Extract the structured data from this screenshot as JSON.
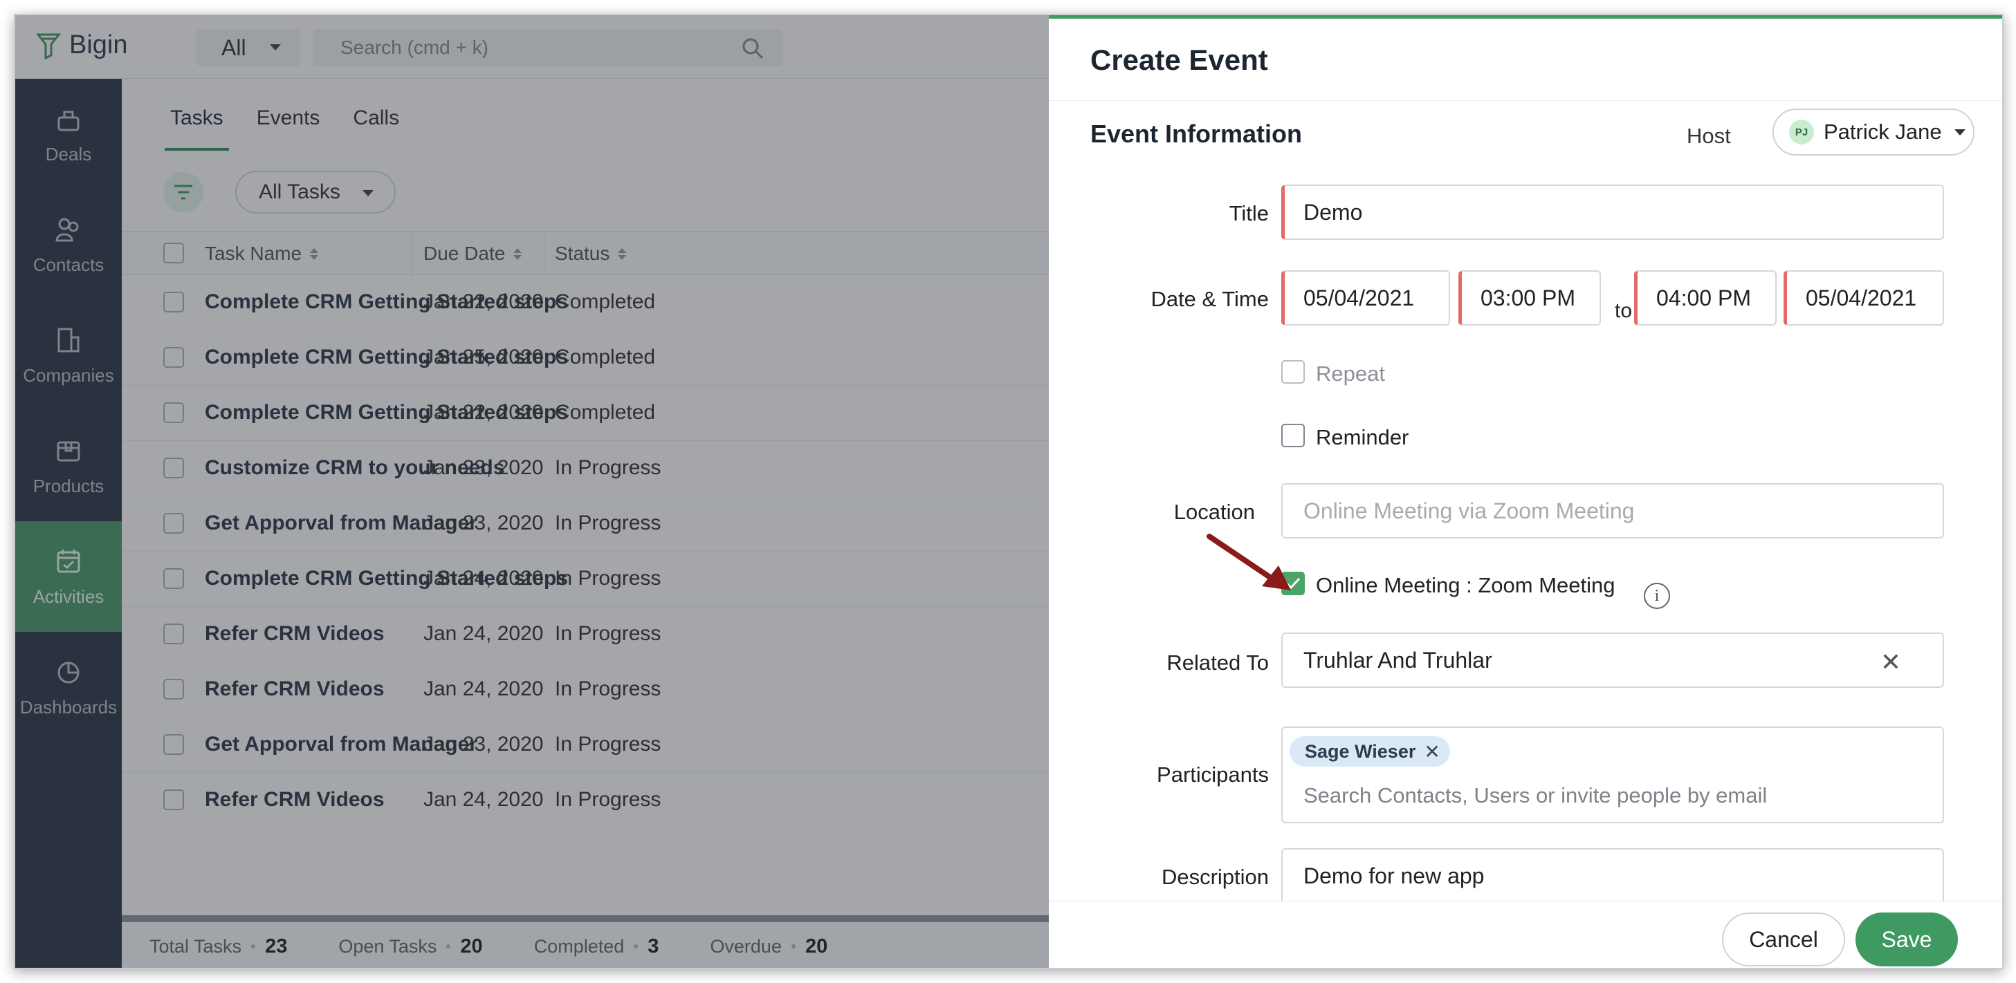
{
  "app": {
    "brand": "Bigin",
    "scope": "All",
    "search_placeholder": "Search (cmd + k)"
  },
  "sidebar": {
    "items": [
      {
        "label": "Deals",
        "icon": "deals-icon"
      },
      {
        "label": "Contacts",
        "icon": "contacts-icon"
      },
      {
        "label": "Companies",
        "icon": "companies-icon"
      },
      {
        "label": "Products",
        "icon": "products-icon"
      },
      {
        "label": "Activities",
        "icon": "activities-icon",
        "active": true
      },
      {
        "label": "Dashboards",
        "icon": "dashboards-icon"
      }
    ]
  },
  "activities": {
    "tabs": [
      "Tasks",
      "Events",
      "Calls"
    ],
    "view": "All Tasks",
    "columns": [
      "Task Name",
      "Due Date",
      "Status"
    ],
    "rows": [
      {
        "name": "Complete CRM Getting Started steps",
        "due": "Jan 22, 2020",
        "status": "Completed"
      },
      {
        "name": "Complete CRM Getting Started steps",
        "due": "Jan 25, 2020",
        "status": "Completed"
      },
      {
        "name": "Complete CRM Getting Started steps",
        "due": "Jan 22, 2020",
        "status": "Completed"
      },
      {
        "name": "Customize CRM to your needs",
        "due": "Jan 23, 2020",
        "status": "In Progress"
      },
      {
        "name": "Get Apporval from Manager",
        "due": "Jan 23, 2020",
        "status": "In Progress"
      },
      {
        "name": "Complete CRM Getting Started steps",
        "due": "Jan 24, 2020",
        "status": "In Progress"
      },
      {
        "name": "Refer CRM Videos",
        "due": "Jan 24, 2020",
        "status": "In Progress"
      },
      {
        "name": "Refer CRM Videos",
        "due": "Jan 24, 2020",
        "status": "In Progress"
      },
      {
        "name": "Get Apporval from Manager",
        "due": "Jan 23, 2020",
        "status": "In Progress"
      },
      {
        "name": "Refer CRM Videos",
        "due": "Jan 24, 2020",
        "status": "In Progress"
      }
    ],
    "footer": [
      {
        "label": "Total Tasks",
        "value": "23"
      },
      {
        "label": "Open Tasks",
        "value": "20"
      },
      {
        "label": "Completed",
        "value": "3"
      },
      {
        "label": "Overdue",
        "value": "20"
      }
    ]
  },
  "event_form": {
    "title": "Create Event",
    "section": "Event Information",
    "host_label": "Host",
    "host_initials": "PJ",
    "host_name": "Patrick Jane",
    "labels": {
      "title": "Title",
      "date_time": "Date & Time",
      "location": "Location",
      "related_to": "Related To",
      "participants": "Participants",
      "description": "Description"
    },
    "title_value": "Demo",
    "start_date": "05/04/2021",
    "start_time": "03:00 PM",
    "to": "to",
    "end_time": "04:00 PM",
    "end_date": "05/04/2021",
    "repeat_label": "Repeat",
    "reminder_label": "Reminder",
    "location_placeholder": "Online Meeting via Zoom Meeting",
    "online_meeting_label": "Online Meeting : Zoom Meeting",
    "online_meeting_checked": true,
    "related_to_value": "Truhlar And Truhlar",
    "participant_chip": "Sage Wieser",
    "participants_placeholder": "Search Contacts, Users or invite people by email",
    "description_value": "Demo for new app",
    "cancel_label": "Cancel",
    "save_label": "Save"
  },
  "colors": {
    "accent": "#3f9a62",
    "sidebar_bg": "#2b3846",
    "required_marker": "#e26a6a",
    "annotation_arrow": "#8b1a1a"
  }
}
